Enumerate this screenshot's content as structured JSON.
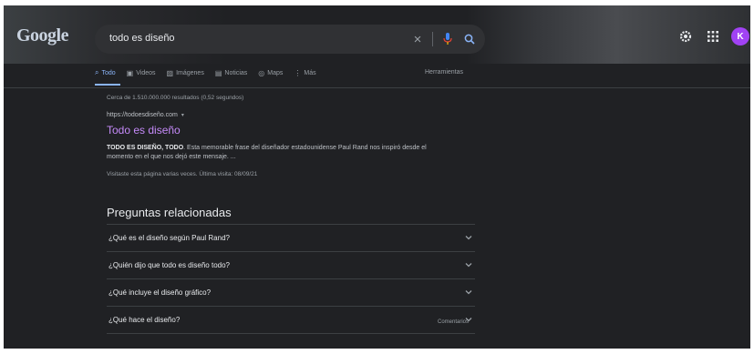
{
  "header": {
    "logo": "Google",
    "search_value": "todo es diseño",
    "avatar_letter": "K"
  },
  "tabs": [
    {
      "label": "Todo",
      "icon": "search-icon"
    },
    {
      "label": "Videos",
      "icon": "video-icon"
    },
    {
      "label": "Imágenes",
      "icon": "image-icon"
    },
    {
      "label": "Noticias",
      "icon": "news-icon"
    },
    {
      "label": "Maps",
      "icon": "map-pin-icon"
    },
    {
      "label": "Más",
      "icon": "more-vert-icon"
    }
  ],
  "tools_label": "Herramientas",
  "stats": "Cerca de 1.510.000.000 resultados (0,52 segundos)",
  "result": {
    "url": "https://todoesdiseño.com",
    "title": "Todo es diseño",
    "snippet_bold": "TODO ES DISEÑO, TODO",
    "snippet_rest": ". Esta memorable frase del diseñador estadounidense Paul Rand nos inspiró desde el momento en el que nos dejó este mensaje. ...",
    "visited": "Visitaste esta página varias veces. Última visita: 08/09/21"
  },
  "related": {
    "title": "Preguntas relacionadas",
    "questions": [
      "¿Qué es el diseño según Paul Rand?",
      "¿Quién dijo que todo es diseño todo?",
      "¿Qué incluye el diseño gráfico?",
      "¿Qué hace el diseño?"
    ],
    "comments_label": "Comentarios"
  },
  "colors": {
    "background": "#202124",
    "link_visited": "#c58af9",
    "accent": "#8ab4f8",
    "avatar": "#a142f4"
  }
}
